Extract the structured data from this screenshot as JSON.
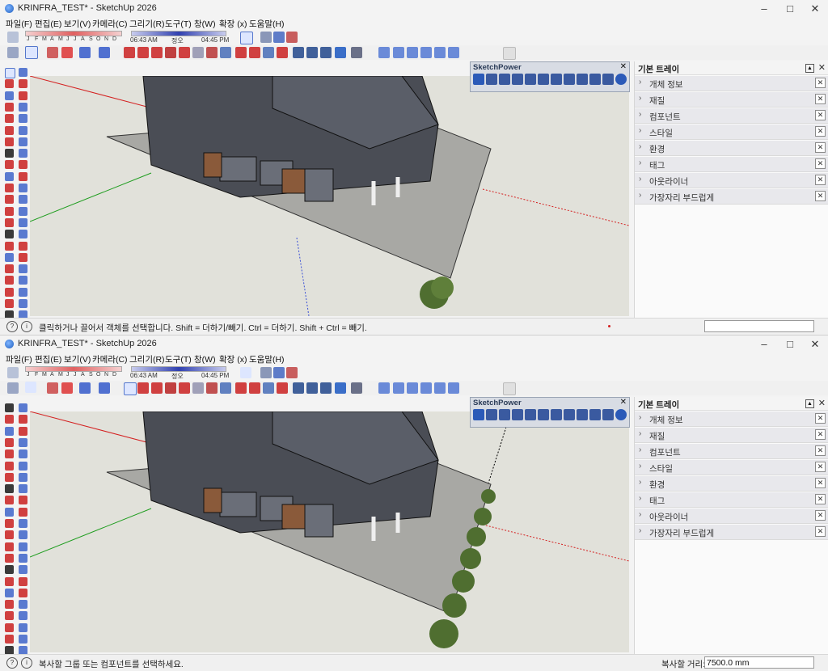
{
  "window1": {
    "title": "KRINFRA_TEST* - SketchUp 2026",
    "menu": [
      "파일(F)",
      "편집(E)",
      "보기(V)",
      "카메라(C)",
      "그리기(R)",
      "도구(T)",
      "창(W)",
      "확장 (x)",
      "도움말(H)"
    ],
    "shadow": {
      "months": [
        "J",
        "F",
        "M",
        "A",
        "M",
        "J",
        "J",
        "A",
        "S",
        "O",
        "N",
        "D"
      ],
      "time_start": "06:43 AM",
      "time_mid": "정오",
      "time_end": "04:45 PM"
    },
    "sketchpower_title": "SketchPower",
    "tray": {
      "title": "기본 트레이",
      "panels": [
        "개체 정보",
        "재질",
        "컴포넌트",
        "스타일",
        "환경",
        "태그",
        "아웃라이너",
        "가장자리 부드럽게"
      ]
    },
    "status_text": "클릭하거나 끌어서 객체를 선택합니다. Shift = 더하기/빼기. Ctrl = 더하기. Shift + Ctrl = 빼기."
  },
  "window2": {
    "title": "KRINFRA_TEST* - SketchUp 2026",
    "menu": [
      "파일(F)",
      "편집(E)",
      "보기(V)",
      "카메라(C)",
      "그리기(R)",
      "도구(T)",
      "창(W)",
      "확장 (x)",
      "도움말(H)"
    ],
    "shadow": {
      "months": [
        "J",
        "F",
        "M",
        "A",
        "M",
        "J",
        "J",
        "A",
        "S",
        "O",
        "N",
        "D"
      ],
      "time_start": "06:43 AM",
      "time_mid": "정오",
      "time_end": "04:45 PM"
    },
    "sketchpower_title": "SketchPower",
    "tray": {
      "title": "기본 트레이",
      "panels": [
        "개체 정보",
        "재질",
        "컴포넌트",
        "스타일",
        "환경",
        "태그",
        "아웃라이너",
        "가장자리 부드럽게"
      ]
    },
    "status_text": "복사할 그룹 또는 컴포넌트를 선택하세요.",
    "measure_label": "복사할 거리:",
    "measure_value": "7500.0 mm"
  },
  "icons": {
    "minimize": "minimize-icon",
    "maximize": "maximize-icon",
    "close": "close-icon",
    "tool_palette": [
      "select-icon",
      "paint-icon",
      "line-icon",
      "rectangle-icon",
      "circle-icon",
      "arc-icon",
      "move-icon",
      "rotate-icon",
      "scale-icon",
      "tape-icon",
      "text-icon",
      "orbit-icon",
      "zoom-icon"
    ]
  },
  "colors": {
    "axis_red": "#d42020",
    "axis_green": "#1f9d1f",
    "axis_blue": "#3a4fd6",
    "ground": "#bdbdb2",
    "sky": "#ffffff"
  }
}
